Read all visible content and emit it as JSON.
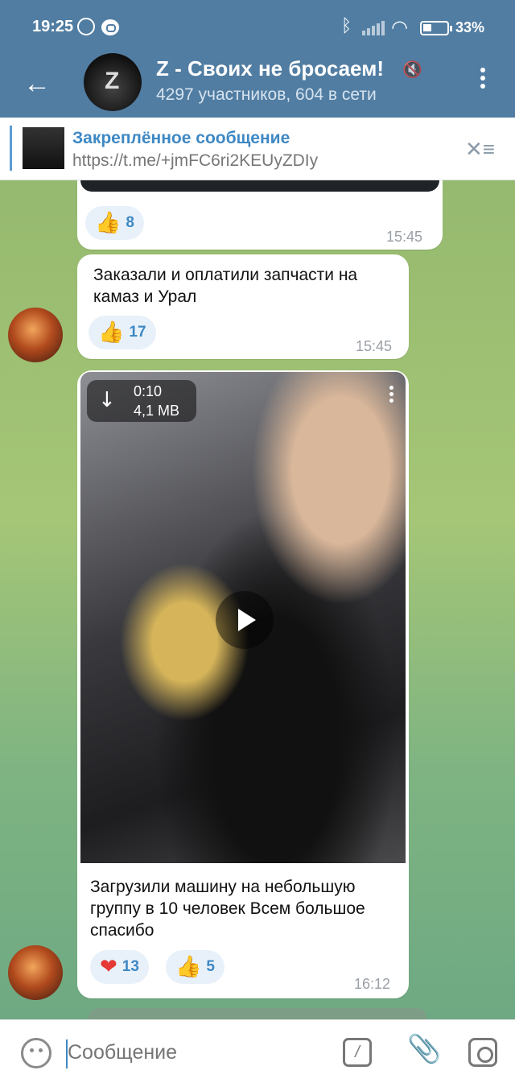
{
  "status_bar": {
    "time": "19:25",
    "battery": "33%"
  },
  "header": {
    "title": "Z - Своих не бросаем!",
    "subtitle": "4297 участников, 604 в сети",
    "back_icon": "back-arrow-icon",
    "mute_icon": "muted-icon"
  },
  "pinned": {
    "title": "Закреплённое сообщение",
    "text": "https://t.me/+jmFC6ri2KEUyZDIy"
  },
  "messages": [
    {
      "reaction_emoji": "👍",
      "reaction_count": "8",
      "time": "15:45"
    },
    {
      "text": "Заказали и оплатили запчасти на камаз и Урал",
      "reaction_emoji": "👍",
      "reaction_count": "17",
      "time": "15:45"
    },
    {
      "video_duration": "0:10",
      "video_size": "4,1 MB",
      "text": "Загрузили машину на небольшую группу в 10 человек Всем большое спасибо",
      "reactions": [
        {
          "emoji": "❤",
          "count": "13"
        },
        {
          "emoji": "👍",
          "count": "5"
        }
      ],
      "time": "16:12"
    }
  ],
  "input": {
    "placeholder": "Сообщение"
  },
  "colors": {
    "header": "#517da2",
    "accent": "#3e88c4",
    "heart": "#e53935"
  }
}
